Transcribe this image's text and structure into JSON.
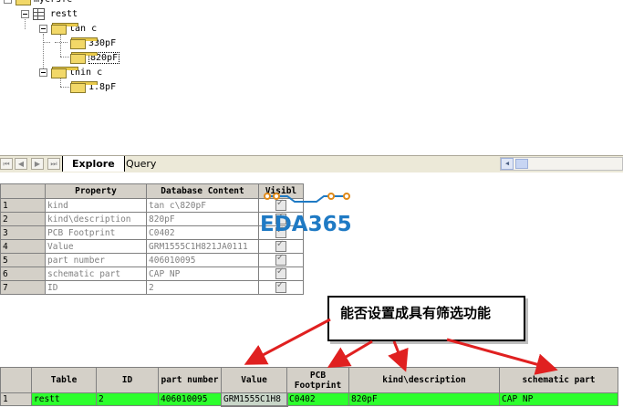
{
  "tree": {
    "root_label": "mycrsfc",
    "table_label": "restt",
    "group1_label": "tan c",
    "group1_items": [
      "330pF",
      "820pF"
    ],
    "group2_label": "thin c",
    "group2_items": [
      "1.8pF"
    ]
  },
  "tabs": {
    "nav_first": "⏮",
    "nav_prev": "◀",
    "nav_next": "▶",
    "nav_last": "⏭",
    "explore": "Explore",
    "query": "Query"
  },
  "property_grid": {
    "headers": [
      "Property",
      "Database Content",
      "Visibl"
    ],
    "rows": [
      {
        "num": "1",
        "property": "kind",
        "content": "tan c\\820pF"
      },
      {
        "num": "2",
        "property": "kind\\description",
        "content": "820pF"
      },
      {
        "num": "3",
        "property": "PCB Footprint",
        "content": "C0402"
      },
      {
        "num": "4",
        "property": "Value",
        "content": "GRM1555C1H821JA0111"
      },
      {
        "num": "5",
        "property": "part number",
        "content": "406010095"
      },
      {
        "num": "6",
        "property": "schematic part",
        "content": "CAP NP"
      },
      {
        "num": "7",
        "property": "ID",
        "content": "2"
      }
    ]
  },
  "watermark": {
    "text": "EDA365",
    "color": "#1f7ac4",
    "accent": "#e08a1a"
  },
  "callout": {
    "text": "能否设置成具有筛选功能"
  },
  "results": {
    "headers": [
      "Table",
      "ID",
      "part number",
      "Value",
      "PCB Footprint",
      "kind\\description",
      "schematic part"
    ],
    "row": {
      "num": "1",
      "cells": [
        "restt",
        "2",
        "406010095",
        "GRM1555C1H8",
        "C0402",
        "820pF",
        "CAP NP"
      ]
    },
    "row_color": "#2dff2d"
  },
  "arrow_color": "#e02020"
}
